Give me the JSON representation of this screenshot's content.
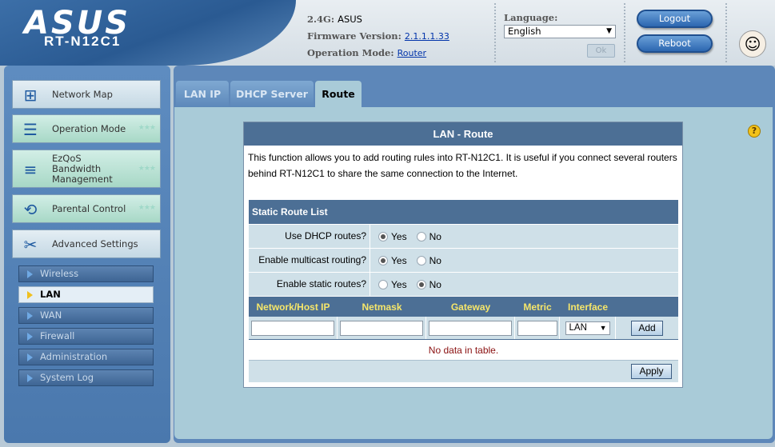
{
  "header": {
    "brand": "ASUS",
    "model": "RT-N12C1",
    "band_label": "2.4G:",
    "band_value": "ASUS",
    "firmware_label": "Firmware Version:",
    "firmware_value": "2.1.1.1.33",
    "opmode_label": "Operation Mode:",
    "opmode_value": "Router",
    "language_label": "Language:",
    "language_value": "English",
    "ok_label": "Ok",
    "logout_label": "Logout",
    "reboot_label": "Reboot"
  },
  "sidebar": {
    "main_items": [
      {
        "label": "Network Map",
        "icon": "network-map-icon"
      },
      {
        "label": "Operation Mode",
        "icon": "router-icon"
      },
      {
        "label": "EzQoS Bandwidth Management",
        "icon": "qos-icon"
      },
      {
        "label": "Parental Control",
        "icon": "parental-control-icon"
      },
      {
        "label": "Advanced Settings",
        "icon": "tools-icon"
      }
    ],
    "sub_items": [
      {
        "label": "Wireless"
      },
      {
        "label": "LAN",
        "active": true
      },
      {
        "label": "WAN"
      },
      {
        "label": "Firewall"
      },
      {
        "label": "Administration"
      },
      {
        "label": "System Log"
      }
    ]
  },
  "tabs": [
    {
      "label": "LAN IP"
    },
    {
      "label": "DHCP Server"
    },
    {
      "label": "Route",
      "active": true
    }
  ],
  "panel": {
    "title": "LAN - Route",
    "description": "This function allows you to add routing rules into RT-N12C1. It is useful if you connect several routers behind RT-N12C1 to share the same connection to the Internet.",
    "list_title": "Static Route List",
    "fields": [
      {
        "label": "Use DHCP routes?",
        "yes": "Yes",
        "no": "No",
        "selected": "Yes"
      },
      {
        "label": "Enable multicast routing?",
        "yes": "Yes",
        "no": "No",
        "selected": "Yes"
      },
      {
        "label": "Enable static routes?",
        "yes": "Yes",
        "no": "No",
        "selected": "No"
      }
    ],
    "columns": [
      "Network/Host IP",
      "Netmask",
      "Gateway",
      "Metric",
      "Interface"
    ],
    "interface_value": "LAN",
    "add_label": "Add",
    "empty_message": "No data in table.",
    "apply_label": "Apply"
  },
  "colors": {
    "accent": "#4c6f95",
    "sidebar": "#5e8cc0",
    "content_bg": "#a9cbd8"
  }
}
